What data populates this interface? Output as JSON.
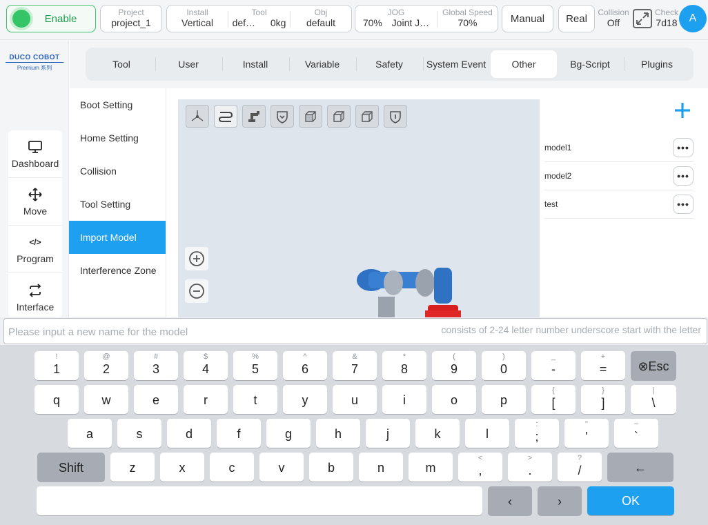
{
  "status_bar": {
    "enable_label": "Enable",
    "project": {
      "label": "Project",
      "value": "project_1"
    },
    "install": {
      "label": "Install",
      "value": "Vertical"
    },
    "tool": {
      "label": "Tool",
      "value": "def…",
      "weight": "0kg"
    },
    "obj": {
      "label": "Obj",
      "value": "default"
    },
    "jog": {
      "label": "JOG",
      "percent": "70%",
      "mode": "Joint J…"
    },
    "global_speed": {
      "label": "Global Speed",
      "value": "70%"
    },
    "manual_label": "Manual",
    "real_label": "Real",
    "collision": {
      "label": "Collision",
      "value": "Off"
    },
    "check": {
      "label": "Check",
      "value": "7d18"
    },
    "avatar_letter": "A",
    "enable_color": "#35c466"
  },
  "logo": {
    "brand": "DUCO COBOT",
    "series": "Premium 系列"
  },
  "sidebar": {
    "items": [
      {
        "label": "Dashboard",
        "icon": "monitor-icon"
      },
      {
        "label": "Move",
        "icon": "move-arrows-icon"
      },
      {
        "label": "Program",
        "icon": "code-icon"
      },
      {
        "label": "Interface",
        "icon": "swap-arrows-icon"
      }
    ]
  },
  "tabs": {
    "items": [
      "Tool",
      "User",
      "Install",
      "Variable",
      "Safety",
      "System Event",
      "Other",
      "Bg-Script",
      "Plugins"
    ],
    "active": "Other"
  },
  "submenu": {
    "items": [
      "Boot Setting",
      "Home Setting",
      "Collision",
      "Tool Setting",
      "Import Model",
      "Interference Zone"
    ],
    "active": "Import Model"
  },
  "viewport": {
    "toolbar_icons": [
      "axes-icon",
      "path-icon",
      "robot-icon",
      "shield-icon",
      "cube-front-icon",
      "cube-side-icon",
      "cube-top-icon",
      "shield-info-icon"
    ],
    "zoom_in_icon": "zoom-in-icon",
    "zoom_out_icon": "zoom-out-icon"
  },
  "models": {
    "add_icon": "plus-icon",
    "items": [
      "model1",
      "model2",
      "test"
    ],
    "more_label": "•••"
  },
  "input": {
    "placeholder": "Please input a new name for the model",
    "value": "",
    "hint": "consists of 2-24 letter number underscore start with the letter"
  },
  "keyboard": {
    "row1": [
      {
        "p": "1",
        "s": "!"
      },
      {
        "p": "2",
        "s": "@"
      },
      {
        "p": "3",
        "s": "#"
      },
      {
        "p": "4",
        "s": "$"
      },
      {
        "p": "5",
        "s": "%"
      },
      {
        "p": "6",
        "s": "^"
      },
      {
        "p": "7",
        "s": "&"
      },
      {
        "p": "8",
        "s": "*"
      },
      {
        "p": "9",
        "s": "("
      },
      {
        "p": "0",
        "s": ")"
      },
      {
        "p": "-",
        "s": "_"
      },
      {
        "p": "=",
        "s": "+"
      }
    ],
    "esc_label": "⊗Esc",
    "row2": [
      {
        "p": "q",
        "s": ""
      },
      {
        "p": "w",
        "s": ""
      },
      {
        "p": "e",
        "s": ""
      },
      {
        "p": "r",
        "s": ""
      },
      {
        "p": "t",
        "s": ""
      },
      {
        "p": "y",
        "s": ""
      },
      {
        "p": "u",
        "s": ""
      },
      {
        "p": "i",
        "s": ""
      },
      {
        "p": "o",
        "s": ""
      },
      {
        "p": "p",
        "s": ""
      },
      {
        "p": "[",
        "s": "{"
      },
      {
        "p": "]",
        "s": "}"
      },
      {
        "p": "\\",
        "s": "|"
      }
    ],
    "row3": [
      {
        "p": "a",
        "s": ""
      },
      {
        "p": "s",
        "s": ""
      },
      {
        "p": "d",
        "s": ""
      },
      {
        "p": "f",
        "s": ""
      },
      {
        "p": "g",
        "s": ""
      },
      {
        "p": "h",
        "s": ""
      },
      {
        "p": "j",
        "s": ""
      },
      {
        "p": "k",
        "s": ""
      },
      {
        "p": "l",
        "s": ""
      },
      {
        "p": ";",
        "s": ":"
      },
      {
        "p": "'",
        "s": "\""
      },
      {
        "p": "`",
        "s": "~"
      }
    ],
    "shift_label": "Shift",
    "row4": [
      {
        "p": "z",
        "s": ""
      },
      {
        "p": "x",
        "s": ""
      },
      {
        "p": "c",
        "s": ""
      },
      {
        "p": "v",
        "s": ""
      },
      {
        "p": "b",
        "s": ""
      },
      {
        "p": "n",
        "s": ""
      },
      {
        "p": "m",
        "s": ""
      },
      {
        "p": ",",
        "s": "<"
      },
      {
        "p": ".",
        "s": ">"
      },
      {
        "p": "/",
        "s": "?"
      }
    ],
    "backspace_label": "←",
    "left_label": "‹",
    "right_label": "›",
    "ok_label": "OK",
    "ok_color": "#1ea0f0"
  }
}
